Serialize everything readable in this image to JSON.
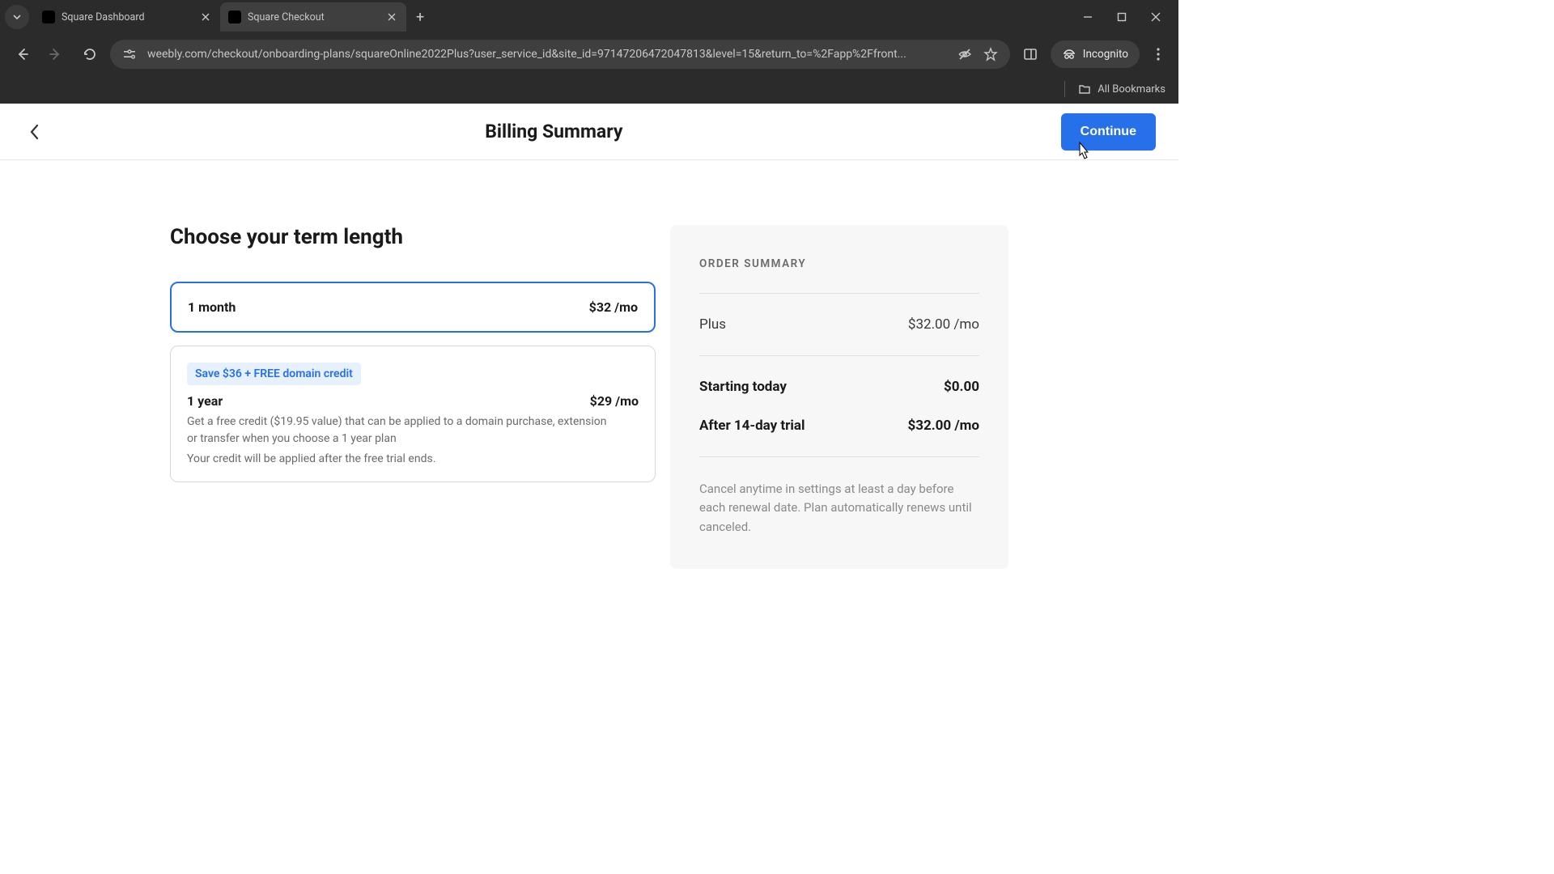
{
  "browser": {
    "tabs": [
      {
        "title": "Square Dashboard",
        "active": false
      },
      {
        "title": "Square Checkout",
        "active": true
      }
    ],
    "url": "weebly.com/checkout/onboarding-plans/squareOnline2022Plus?user_service_id&site_id=97147206472047813&level=15&return_to=%2Fapp%2Ffront...",
    "incognito_label": "Incognito",
    "all_bookmarks": "All Bookmarks"
  },
  "page": {
    "title": "Billing Summary",
    "continue_label": "Continue"
  },
  "term_section": {
    "heading": "Choose your term length",
    "options": [
      {
        "name": "1 month",
        "price": "$32 /mo",
        "selected": true
      },
      {
        "promo": "Save $36 + FREE domain credit",
        "name": "1 year",
        "price": "$29 /mo",
        "desc": "Get a free credit ($19.95 value) that can be applied to a domain purchase, extension or transfer when you choose a 1 year plan",
        "note": "Your credit will be applied after the free trial ends.",
        "selected": false
      }
    ]
  },
  "order_summary": {
    "title": "ORDER SUMMARY",
    "plan_name": "Plus",
    "plan_price": "$32.00 /mo",
    "starting_label": "Starting today",
    "starting_value": "$0.00",
    "after_trial_label": "After 14-day trial",
    "after_trial_value": "$32.00 /mo",
    "cancel_text": "Cancel anytime in settings at least a day before each renewal date. Plan automatically renews until canceled."
  }
}
